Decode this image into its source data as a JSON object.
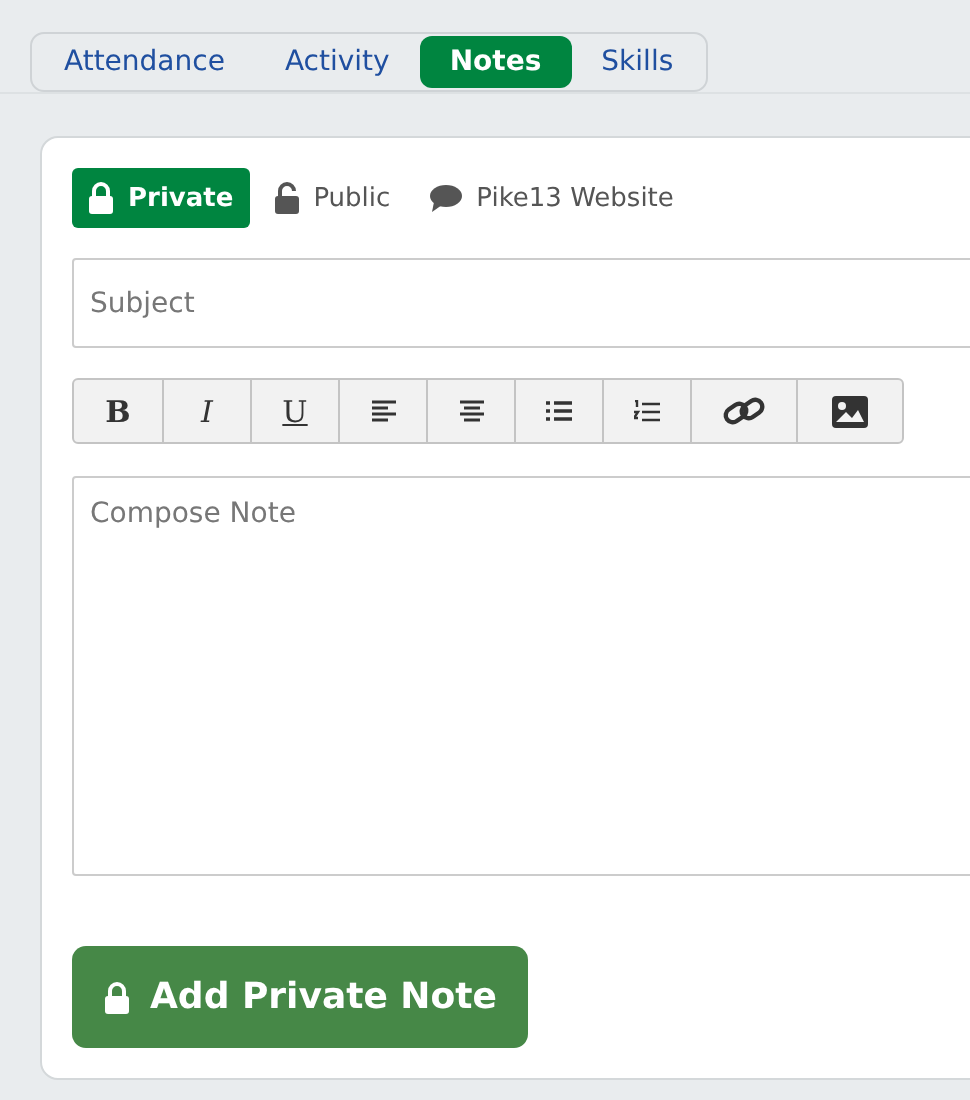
{
  "tabs": [
    {
      "label": "Attendance",
      "selected": false
    },
    {
      "label": "Activity",
      "selected": false
    },
    {
      "label": "Notes",
      "selected": true
    },
    {
      "label": "Skills",
      "selected": false
    }
  ],
  "visibility": [
    {
      "kind": "private",
      "label": "Private",
      "selected": true
    },
    {
      "kind": "public",
      "label": "Public",
      "selected": false
    },
    {
      "kind": "website",
      "label": "Pike13 Website",
      "selected": false
    }
  ],
  "subject": {
    "placeholder": "Subject"
  },
  "toolbar": [
    {
      "kind": "bold",
      "label": "B"
    },
    {
      "kind": "italic",
      "label": "I"
    },
    {
      "kind": "underline",
      "label": "U"
    },
    {
      "kind": "align-left"
    },
    {
      "kind": "align-center"
    },
    {
      "kind": "bullet-list"
    },
    {
      "kind": "numbered-list"
    },
    {
      "kind": "link"
    },
    {
      "kind": "image"
    }
  ],
  "body": {
    "placeholder": "Compose Note"
  },
  "submit": {
    "label": "Add Private Note"
  }
}
